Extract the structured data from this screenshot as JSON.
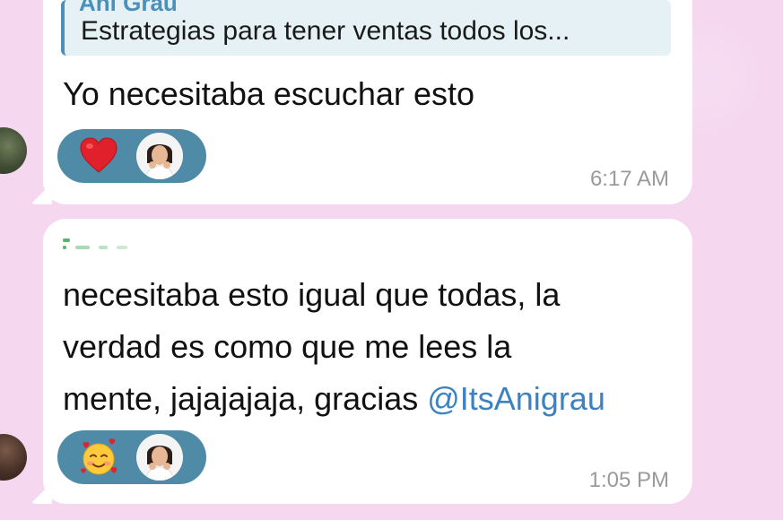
{
  "messages": [
    {
      "reply": {
        "author": "Ani Grau",
        "text": "Estrategias para tener ventas todos los..."
      },
      "lines": [
        "Yo necesitaba escuchar esto"
      ],
      "reaction_icon": "red-heart-icon",
      "time": "6:17 AM"
    },
    {
      "lines": [
        "necesitaba esto igual que todas, la",
        "verdad es como que me lees la",
        "mente, jajajajaja, gracias "
      ],
      "mention": "@ItsAnigrau",
      "reaction_icon": "smiling-face-with-hearts-icon",
      "time": "1:05 PM"
    }
  ],
  "colors": {
    "background": "#f5d8f0",
    "bubble": "#ffffff",
    "reaction_pill": "#4f8aa6",
    "mention": "#3a82c4",
    "reply_accent": "#4a90b8",
    "timestamp": "#9a9a9a"
  }
}
